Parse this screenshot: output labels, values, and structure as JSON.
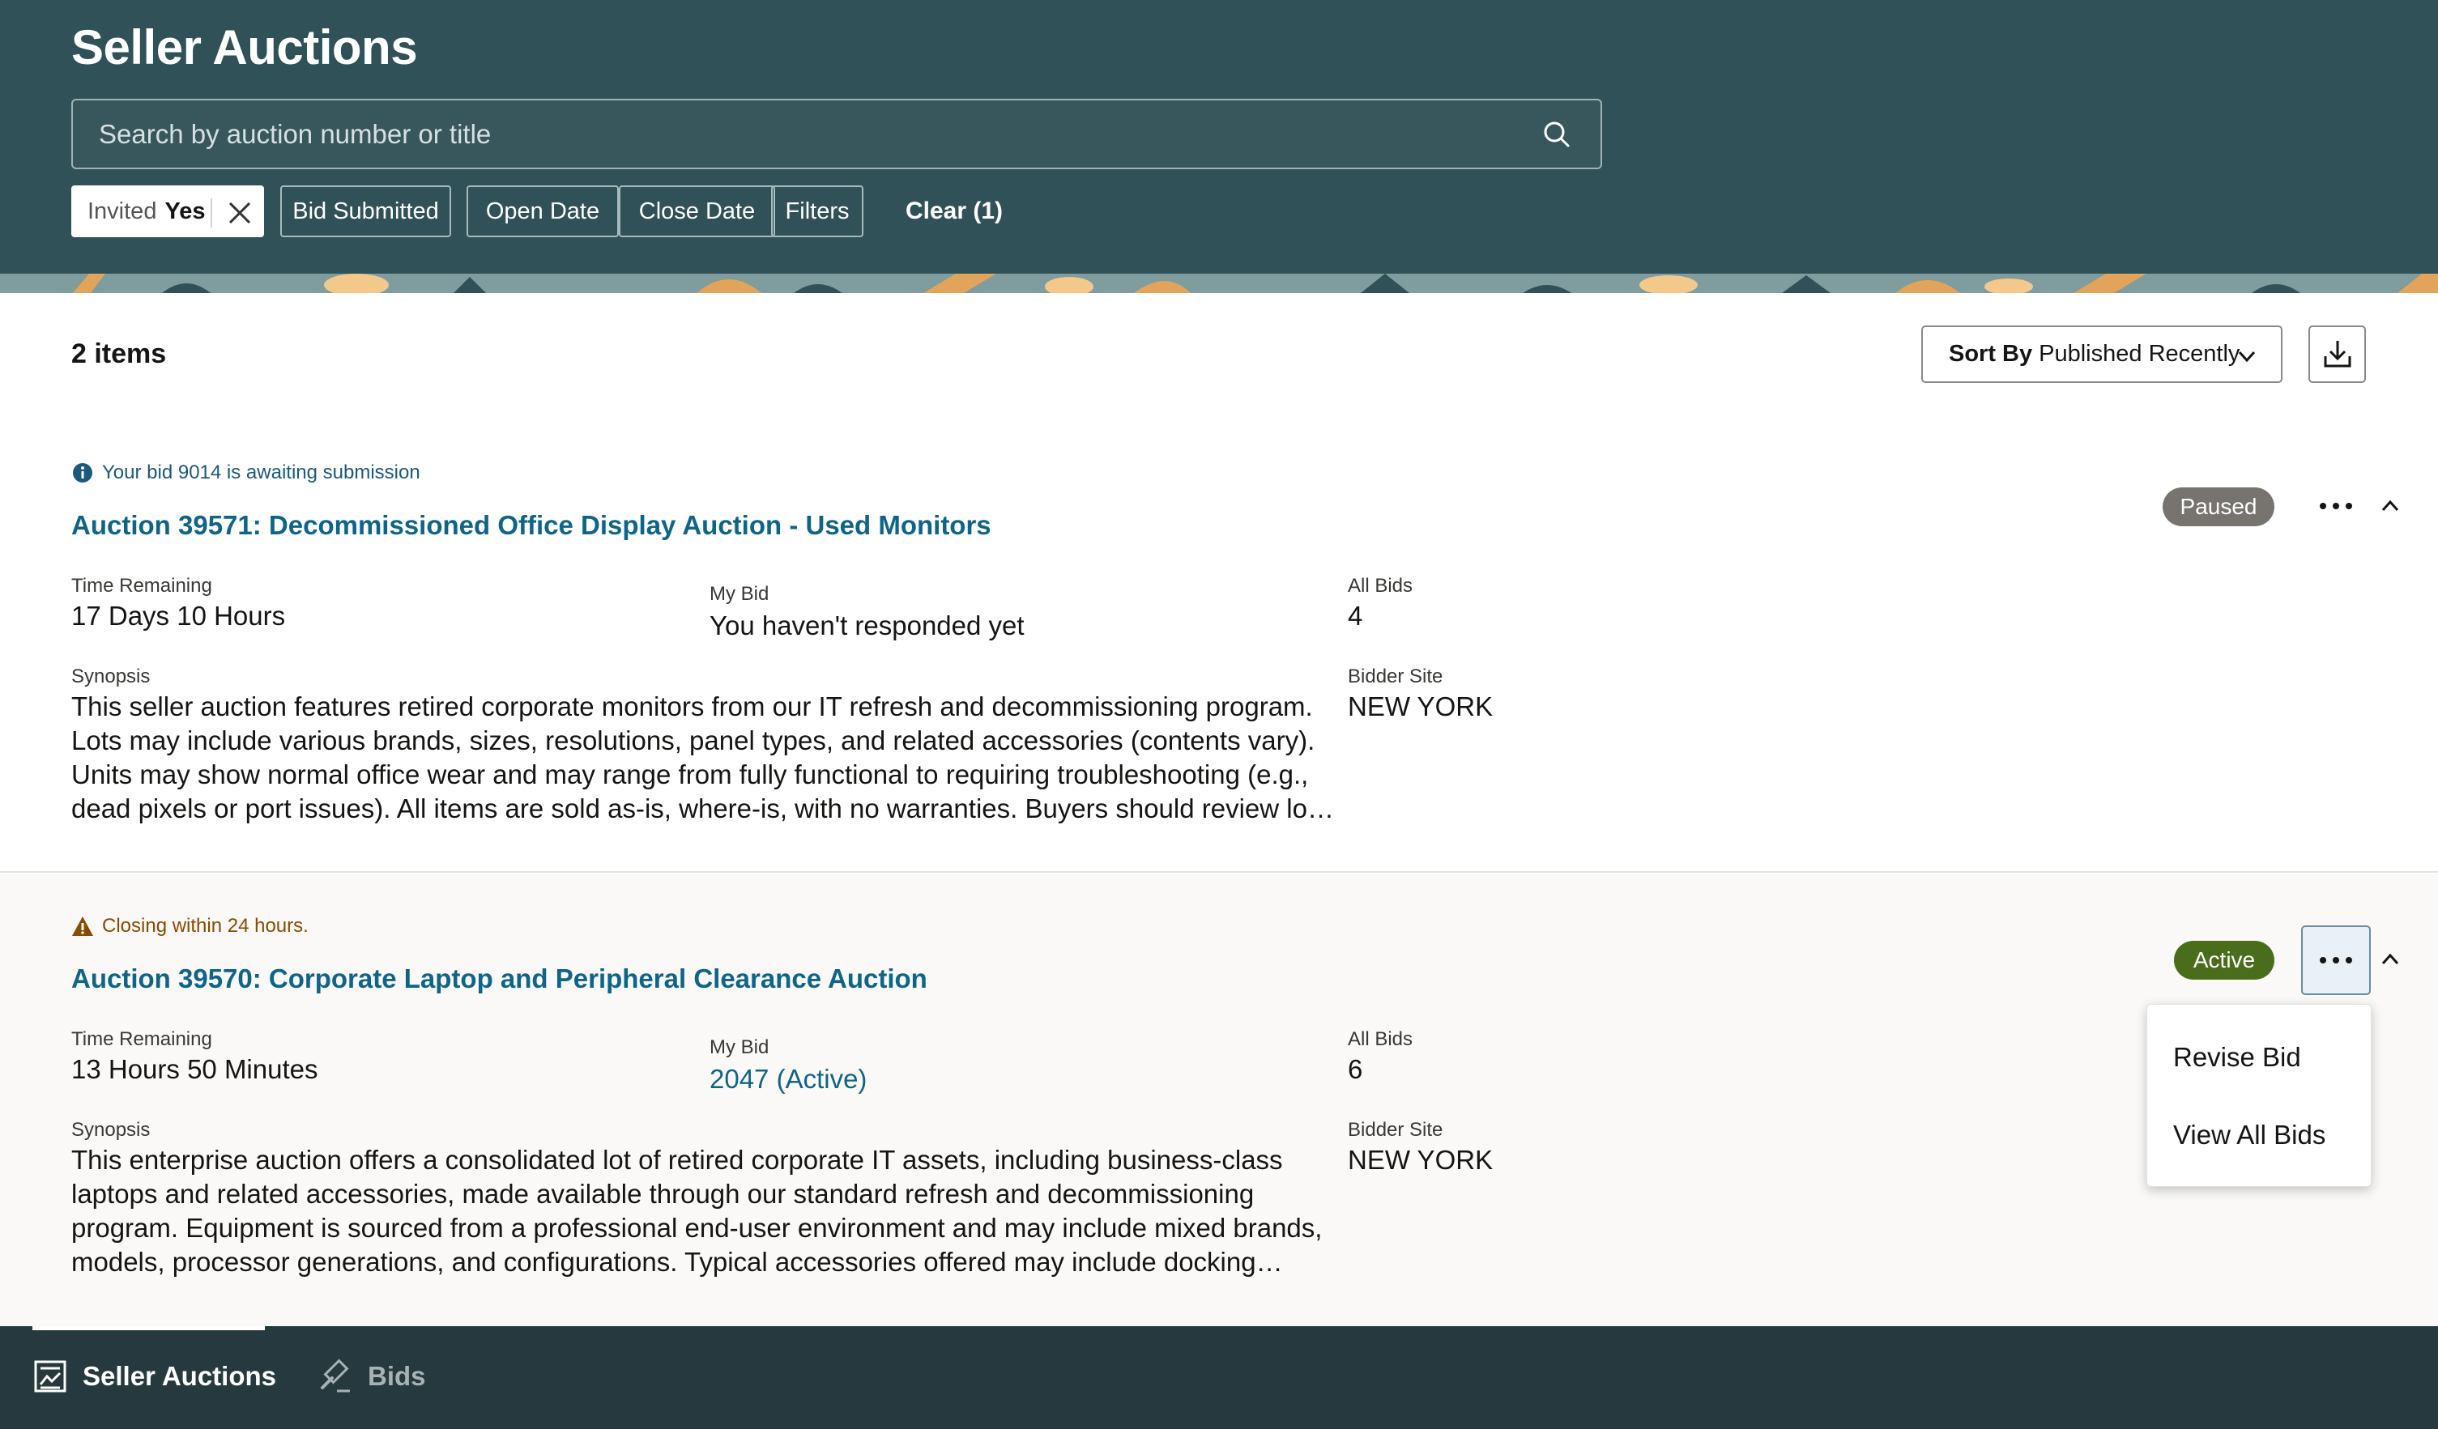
{
  "header": {
    "title": "Seller Auctions",
    "search_placeholder": "Search by auction number or title",
    "chips": {
      "invited_label": "Invited",
      "invited_value": "Yes",
      "bid_submitted": "Bid Submitted",
      "open_date": "Open Date",
      "close_date": "Close Date",
      "filters": "Filters"
    },
    "clear_label": "Clear (1)"
  },
  "toolbar": {
    "items_count": "2 items",
    "sort_label": "Sort By",
    "sort_value": "Published Recently"
  },
  "auctions": [
    {
      "notice": "Your bid 9014 is awaiting submission",
      "notice_type": "info",
      "title": "Auction 39571: Decommissioned Office Display Auction - Used Monitors",
      "status": "Paused",
      "time_remaining_label": "Time Remaining",
      "time_remaining": "17 Days 10 Hours",
      "my_bid_label": "My Bid",
      "my_bid": "You haven't responded yet",
      "all_bids_label": "All Bids",
      "all_bids": "4",
      "synopsis_label": "Synopsis",
      "synopsis": "This seller auction features retired corporate monitors from our IT refresh and decommissioning program. Lots may include various brands, sizes, resolutions, panel types, and related accessories (contents vary). Units may show normal office wear and may range from fully functional to requiring troubleshooting (e.g., dead pixels or port issues). All items are sold as-is, where-is, with no warranties. Buyers should review lot details carefully before bidding.",
      "bidder_site_label": "Bidder Site",
      "bidder_site": "NEW YORK"
    },
    {
      "notice": "Closing within 24 hours.",
      "notice_type": "warning",
      "title": "Auction 39570: Corporate Laptop and Peripheral Clearance Auction",
      "status": "Active",
      "time_remaining_label": "Time Remaining",
      "time_remaining": "13 Hours 50 Minutes",
      "my_bid_label": "My Bid",
      "my_bid": "2047 (Active)",
      "all_bids_label": "All Bids",
      "all_bids": "6",
      "synopsis_label": "Synopsis",
      "synopsis": "This enterprise auction offers a consolidated lot of retired corporate IT assets, including business-class laptops and related accessories, made available through our standard refresh and decommissioning program. Equipment is sourced from a professional end-user environment and may include mixed brands, models, processor generations, and configurations. Typical accessories offered may include docking stations and chargers.",
      "bidder_site_label": "Bidder Site",
      "bidder_site": "NEW YORK"
    }
  ],
  "actions_menu": {
    "items": [
      "Revise Bid",
      "View All Bids"
    ]
  },
  "bottom_nav": {
    "items": [
      "Seller Auctions",
      "Bids"
    ],
    "active": "Seller Auctions"
  },
  "colors": {
    "header_bg": "#2f5157",
    "link": "#0f6587",
    "paused_badge": "#777470",
    "active_badge": "#4a6d1c",
    "nav_bg": "#26393e"
  }
}
